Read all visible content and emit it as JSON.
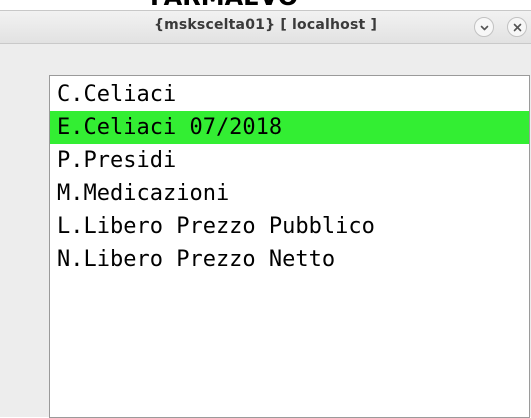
{
  "background": {
    "partial_title": "FARMAEVO"
  },
  "window": {
    "title": "{mskscelta01} [ localhost ]"
  },
  "list": {
    "items": [
      {
        "label": "C.Celiaci",
        "selected": false
      },
      {
        "label": "E.Celiaci 07/2018",
        "selected": true
      },
      {
        "label": "P.Presidi",
        "selected": false
      },
      {
        "label": "M.Medicazioni",
        "selected": false
      },
      {
        "label": "L.Libero Prezzo Pubblico",
        "selected": false
      },
      {
        "label": "N.Libero Prezzo Netto",
        "selected": false
      }
    ]
  },
  "colors": {
    "selection": "#33ee33",
    "window_bg": "#ededed",
    "list_bg": "#ffffff"
  },
  "icons": {
    "minimize": "chevron-down-icon",
    "close": "close-icon"
  }
}
